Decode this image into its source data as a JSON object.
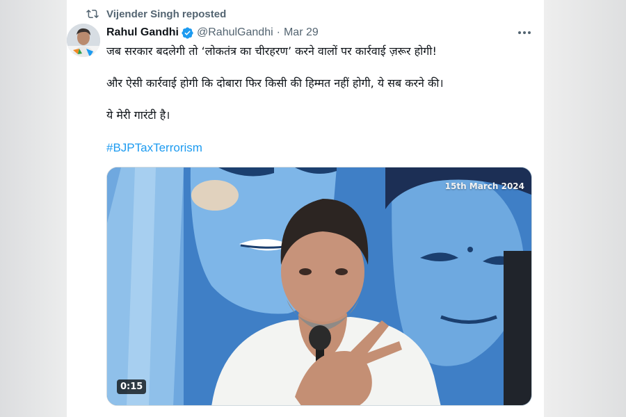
{
  "repost": {
    "text": "Vijender Singh reposted",
    "icon": "repost-icon"
  },
  "tweet": {
    "author_name": "Rahul Gandhi",
    "handle": "@RahulGandhi",
    "separator": "·",
    "date": "Mar 29",
    "verified": true,
    "lines": [
      "जब सरकार बदलेगी तो ‘लोकतंत्र का चीरहरण’ करने वालों पर कार्रवाई ज़रूर होगी!",
      "और ऐसी कार्रवाई होगी कि दोबारा फिर किसी की हिम्मत नहीं होगी, ये सब करने की।",
      "ये मेरी गारंटी है।"
    ],
    "hashtag": "#BJPTaxTerrorism"
  },
  "media": {
    "date_stamp": "15th March 2024",
    "duration": "0:15"
  },
  "colors": {
    "accent": "#1d9bf0",
    "text": "#0f1419",
    "muted": "#536471",
    "mural_blue": "#3f7fc6"
  }
}
